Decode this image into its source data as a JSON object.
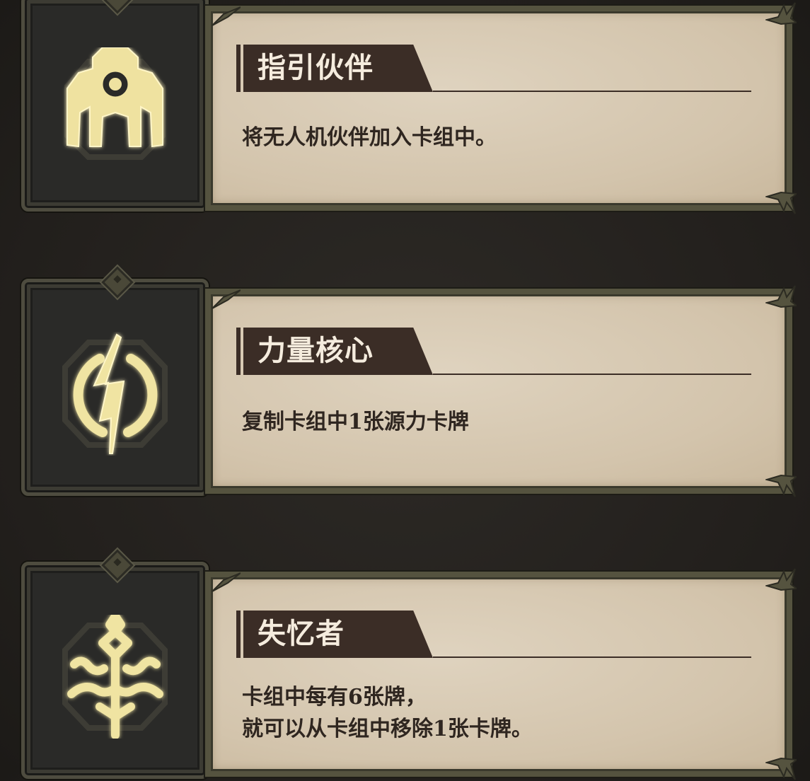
{
  "cards": [
    {
      "title": "指引伙伴",
      "description_lines": [
        "将无人机伙伴加入卡组中。"
      ],
      "icon": "drone-companion-icon"
    },
    {
      "title": "力量核心",
      "description_lines": [
        "复制卡组中1张源力卡牌"
      ],
      "icon": "power-core-lightning-icon"
    },
    {
      "title": "失忆者",
      "description_lines": [
        "卡组中每有6张牌，",
        "就可以从卡组中移除1张卡牌。"
      ],
      "icon": "amnesiac-rune-icon"
    }
  ],
  "colors": {
    "background": "#252320",
    "parchment": "#d8cab4",
    "frame": "#55533f",
    "title_tab": "#3b2d26",
    "title_text": "#f5ecde",
    "body_text": "#2f2620",
    "icon_glow": "#f3e7a8"
  }
}
